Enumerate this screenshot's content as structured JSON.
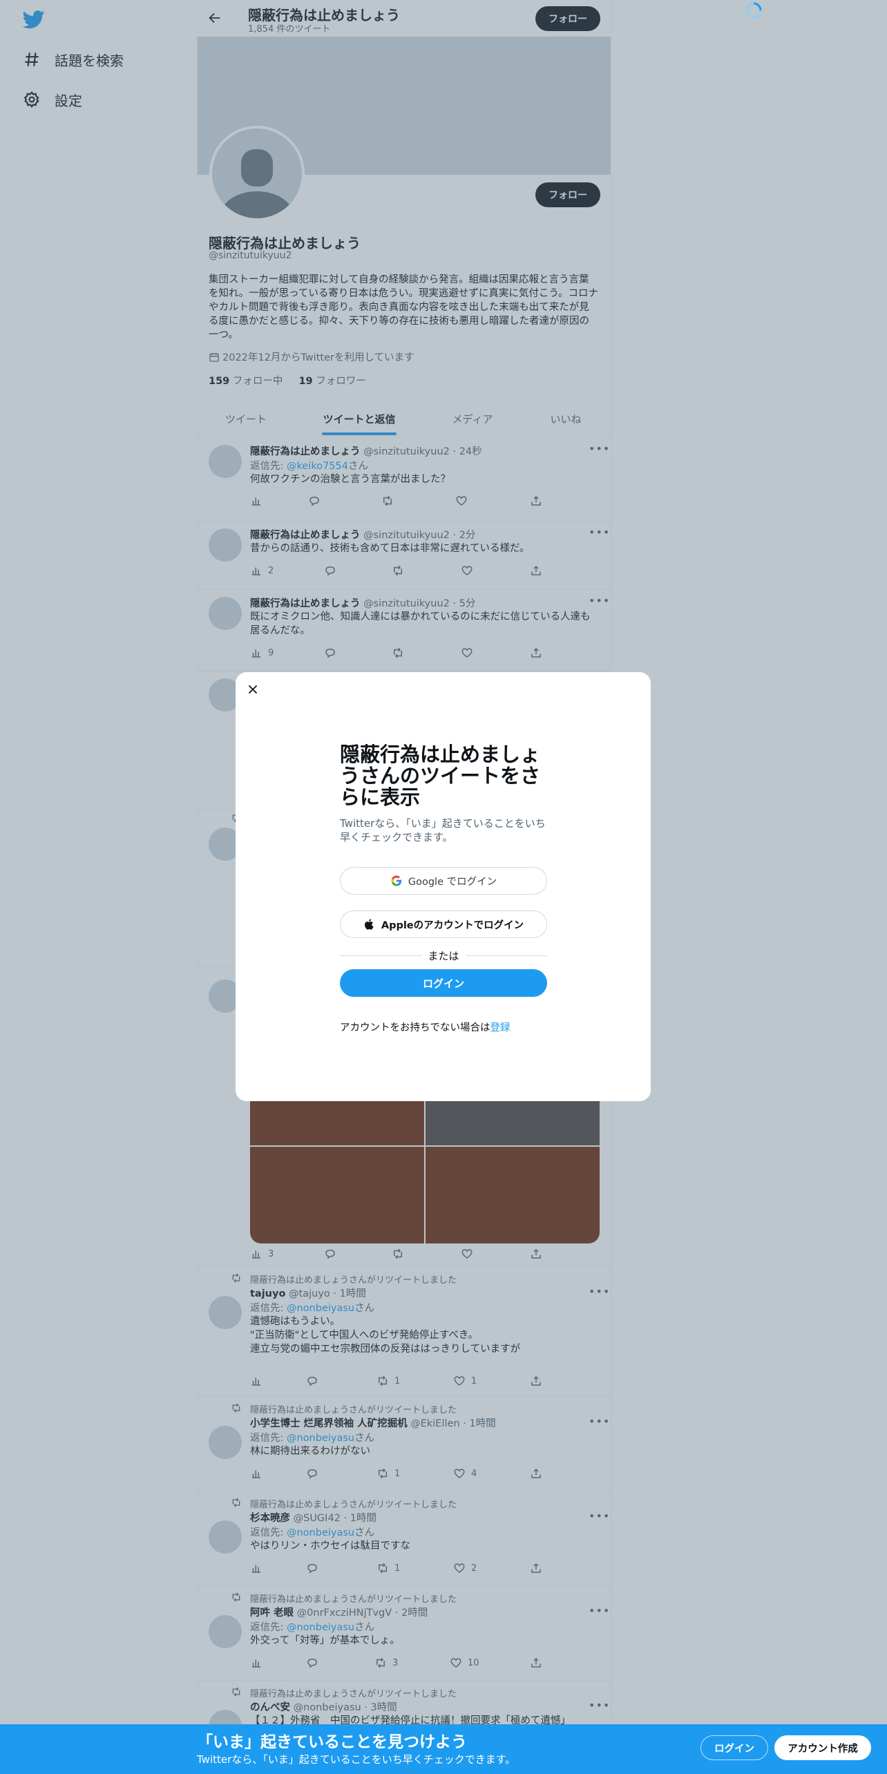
{
  "nav": {
    "logo": "twitter-bird-icon",
    "explore": "話題を検索",
    "settings": "設定"
  },
  "header": {
    "title": "隠蔽行為は止めましょう",
    "tweet_count": "1,854 件のツイート",
    "follow": "フォロー"
  },
  "profile": {
    "follow": "フォロー",
    "name": "隠蔽行為は止めましょう",
    "handle": "@sinzitutuikyuu2",
    "bio": "集団ストーカー組織犯罪に対して自身の経験談から発言。組織は因果応報と言う言葉を知れ。一般が思っている寄り日本は危うい。現実逃避せずに真実に気付こう。コロナやカルト問題で背後も浮き彫り。表向き真面な内容を呟き出した末端も出て来たが見る度に愚かだと感じる。抑々、天下り等の存在に技術も悪用し暗躍した者達が原因の一つ。",
    "joined": "2022年12月からTwitterを利用しています",
    "following_count": "159",
    "following_label": "フォロー中",
    "followers_count": "19",
    "followers_label": "フォロワー"
  },
  "tabs": [
    "ツイート",
    "ツイートと返信",
    "メディア",
    "いいね"
  ],
  "active_tab": "ツイートと返信",
  "tweets": [
    {
      "name": "隠蔽行為は止めましょう",
      "handle": "@sinzitutuikyuu2",
      "time": "· 24秒",
      "reply_prefix": "返信先: ",
      "reply_to": "@keiko7554",
      "reply_suffix": "さん",
      "text": "何故ワクチンの治験と言う言葉が出ました？",
      "views": "",
      "replies": "",
      "retweets": "",
      "likes": ""
    },
    {
      "name": "隠蔽行為は止めましょう",
      "handle": "@sinzitutuikyuu2",
      "time": "· 2分",
      "text": "昔からの話通り、技術も含めて日本は非常に遅れている様だ。",
      "views": "2",
      "replies": "",
      "retweets": "",
      "likes": ""
    },
    {
      "name": "隠蔽行為は止めましょう",
      "handle": "@sinzitutuikyuu2",
      "time": "· 5分",
      "text": "既にオミクロン他、知識人達には暴かれているのに未だに信じている人達も居るんだな。",
      "views": "9",
      "replies": "",
      "retweets": "",
      "likes": ""
    },
    {
      "views": "3",
      "replies": "",
      "retweets": "",
      "likes": ""
    },
    {
      "rt_by": "隠蔽行為は止めましょうさんがリツイートしました",
      "name": "tajuyo",
      "handle": "@tajuyo",
      "time": "· 1時間",
      "reply_prefix": "返信先: ",
      "reply_to": "@nonbeiyasu",
      "reply_suffix": "さん",
      "text_lines": [
        "遺憾砲はもうよい。",
        "\"正当防衛\"として中国人へのビザ発給停止すべき。",
        "連立与党の媚中エセ宗教団体の反発ははっきりしていますが"
      ],
      "views": "",
      "replies": "",
      "retweets": "1",
      "likes": "1"
    },
    {
      "rt_by": "隠蔽行為は止めましょうさんがリツイートしました",
      "name": "小学生博士 烂尾界领袖 人矿挖掘机",
      "handle": "@EkiEllen",
      "time": "· 1時間",
      "reply_prefix": "返信先: ",
      "reply_to": "@nonbeiyasu",
      "reply_suffix": "さん",
      "text": "林に期待出来るわけがない",
      "views": "",
      "replies": "",
      "retweets": "1",
      "likes": "4"
    },
    {
      "rt_by": "隠蔽行為は止めましょうさんがリツイートしました",
      "name": "杉本暁彦",
      "handle": "@SUGI42",
      "time": "· 1時間",
      "reply_prefix": "返信先: ",
      "reply_to": "@nonbeiyasu",
      "reply_suffix": "さん",
      "text": "やはりリン・ホウセイは駄目ですな",
      "views": "",
      "replies": "",
      "retweets": "1",
      "likes": "2"
    },
    {
      "rt_by": "隠蔽行為は止めましょうさんがリツイートしました",
      "name": "阿吽 老眼",
      "handle": "@0nrFxcziHNjTvgV",
      "time": "· 2時間",
      "reply_prefix": "返信先: ",
      "reply_to": "@nonbeiyasu",
      "reply_suffix": "さん",
      "text": "外交って「対等」が基本でしょ。",
      "views": "",
      "replies": "",
      "retweets": "3",
      "likes": "10"
    },
    {
      "rt_by": "隠蔽行為は止めましょうさんがリツイートしました",
      "name": "のんべ安",
      "handle": "@nonbeiyasu",
      "time": "· 3時間",
      "text": "【１２】外務省　中国のビザ発給停止に抗議！撤回要求「極めて遺憾」"
    }
  ],
  "media_colors": [
    "#6d2b0b",
    "#4f4540",
    "#6d2b0b",
    "#6d2b0b"
  ],
  "modal": {
    "title": "隠蔽行為は止めましょうさんのツイートをさらに表示",
    "subtitle": "Twitterなら、「いま」起きていることをいち早くチェックできます。",
    "google": "Google でログイン",
    "apple": "Appleのアカウントでログイン",
    "or": "または",
    "login": "ログイン",
    "signup_prompt": "アカウントをお持ちでない場合は",
    "signup_link": "登録"
  },
  "bottom_bar": {
    "title": "「いま」起きていることを見つけよう",
    "subtitle": "Twitterなら、「いま」起きていることをいち早くチェックできます。",
    "login": "ログイン",
    "signup": "アカウント作成"
  },
  "colors": {
    "accent": "#1d9bf0",
    "text": "#0f1419",
    "secondary": "#536471"
  }
}
